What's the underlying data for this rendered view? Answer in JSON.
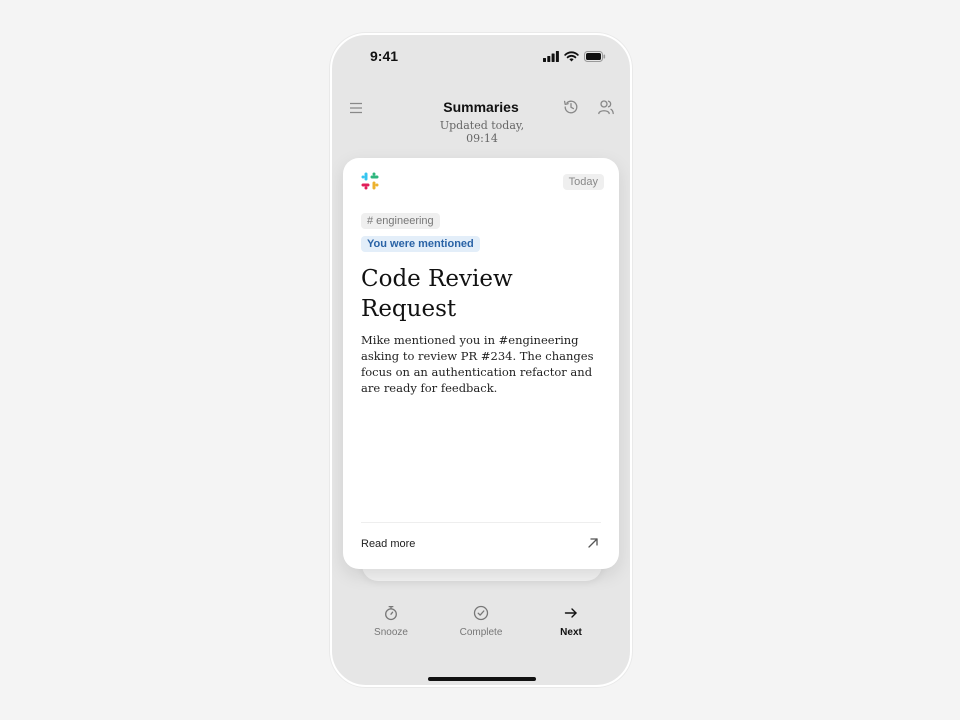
{
  "status_bar": {
    "time": "9:41"
  },
  "header": {
    "title": "Summaries",
    "subtitle": "Updated today, 09:14"
  },
  "card": {
    "app_icon": "slack-logo",
    "date_badge": "Today",
    "channel": "# engineering",
    "mention_tag": "You were mentioned",
    "title": "Code Review Request",
    "body": "Mike mentioned you in #engineering asking to review PR #234. The changes focus on an authentication refactor and are ready for feedback.",
    "read_more": "Read more"
  },
  "actions": [
    {
      "label": "Snooze",
      "icon": "stopwatch-icon"
    },
    {
      "label": "Complete",
      "icon": "check-circle-icon"
    },
    {
      "label": "Next",
      "icon": "arrow-right-icon"
    }
  ],
  "colors": {
    "mention_bg": "#e3eef9",
    "mention_text": "#2a63a6",
    "phone_bg": "#e6e6e6"
  }
}
